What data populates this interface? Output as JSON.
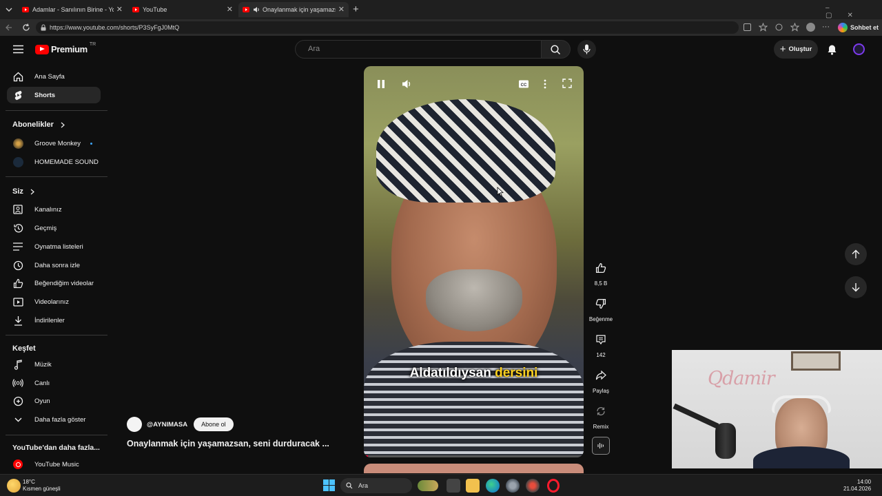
{
  "browser": {
    "tabs": [
      {
        "title": "Adamlar - Sanılının Birine - YouTube"
      },
      {
        "title": "YouTube"
      },
      {
        "title": "Onaylanmak için yaşamazsan"
      }
    ],
    "url": "https://www.youtube.com/shorts/P3SyFgJ0MtQ",
    "chat_label": "Sohbet et"
  },
  "header": {
    "logo_text": "Premium",
    "logo_region": "TR",
    "search_placeholder": "Ara",
    "create_label": "Oluştur"
  },
  "sidebar": {
    "main": [
      {
        "label": "Ana Sayfa",
        "icon": "home-icon"
      },
      {
        "label": "Shorts",
        "icon": "shorts-icon",
        "selected": true
      }
    ],
    "subscriptions_title": "Abonelikler",
    "subscriptions": [
      {
        "label": "Groove Monkey"
      },
      {
        "label": "HOMEMADE SOUND"
      }
    ],
    "you_title": "Siz",
    "you": [
      {
        "label": "Kanalınız",
        "icon": "channel-icon"
      },
      {
        "label": "Geçmiş",
        "icon": "history-icon"
      },
      {
        "label": "Oynatma listeleri",
        "icon": "playlist-icon"
      },
      {
        "label": "Daha sonra izle",
        "icon": "clock-icon"
      },
      {
        "label": "Beğendiğim videolar",
        "icon": "thumbs-up-icon"
      },
      {
        "label": "Videolarınız",
        "icon": "video-icon"
      },
      {
        "label": "İndirilenler",
        "icon": "download-icon"
      }
    ],
    "explore_title": "Keşfet",
    "explore": [
      {
        "label": "Müzik",
        "icon": "music-icon"
      },
      {
        "label": "Canlı",
        "icon": "live-icon"
      },
      {
        "label": "Oyun",
        "icon": "game-icon"
      },
      {
        "label": "Daha fazla göster",
        "icon": "chevron-down-icon"
      }
    ],
    "more_title": "YouTube'dan daha fazla...",
    "more": [
      {
        "label": "YouTube Music",
        "icon": "youtube-music-icon"
      }
    ]
  },
  "short": {
    "channel": "@AYNIMASA",
    "subscribe_label": "Abone ol",
    "title": "Onaylanmak için yaşamazsan, seni durduracak ...",
    "caption_plain": "Aldatıldıysan ",
    "caption_highlight": "dersini",
    "progress_fraction": 0.02
  },
  "actions": {
    "likes": "8,5 B",
    "dislike_label": "Beğenme",
    "comments": "142",
    "share_label": "Paylaş",
    "remix_label": "Remix"
  },
  "webcam_sign": "Qdamir",
  "taskbar": {
    "weather_temp": "18°C",
    "weather_desc": "Kısmen güneşli",
    "search_label": "Ara",
    "time": "14:00",
    "date": "21.04.2026"
  }
}
